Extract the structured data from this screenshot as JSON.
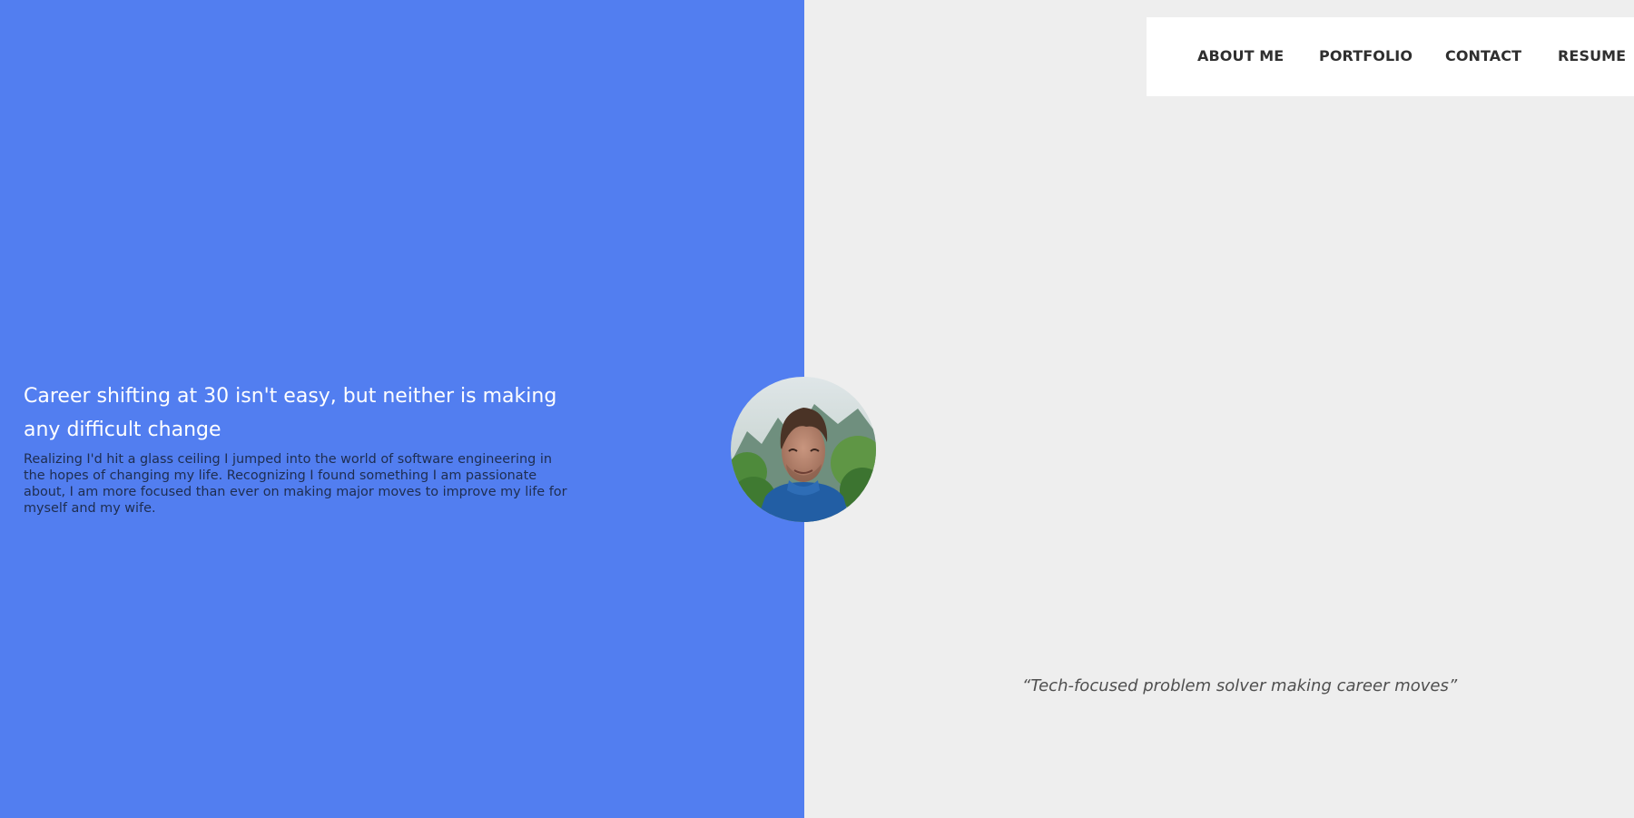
{
  "nav": {
    "items": [
      {
        "label": "ABOUT ME"
      },
      {
        "label": "PORTFOLIO"
      },
      {
        "label": "CONTACT"
      },
      {
        "label": "RESUME"
      }
    ]
  },
  "hero": {
    "headline": "Career shifting at 30 isn't easy, but neither is making any difficult change",
    "intro": "Realizing I'd hit a glass ceiling I jumped into the world of software engineering in the hopes of changing my life. Recognizing I found something I am passionate about, I am more focused than ever on making major moves to improve my life for myself and my wife."
  },
  "tagline": "“Tech-focused problem solver making career moves”",
  "colors": {
    "left_panel": "#527ef0",
    "right_panel": "#eeeeee",
    "nav_background": "#ffffff",
    "nav_text": "#2f2f2f"
  }
}
